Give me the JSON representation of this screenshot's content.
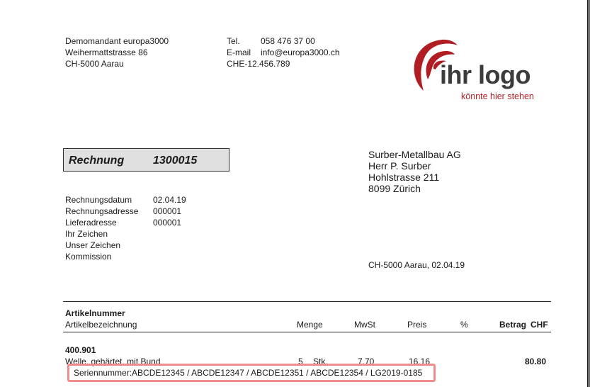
{
  "sender": {
    "line1": "Demomandant europa3000",
    "line2": "Weihermattstrasse 86",
    "line3": "CH-5000 Aarau"
  },
  "contact": {
    "tel_label": "Tel.",
    "tel_value": "058 476 37 00",
    "email_label": "E-mail",
    "email_value": "info@europa3000.ch",
    "vat": "CHE-12.456.789"
  },
  "logo": {
    "main": "ihr logo",
    "sub": "könnte hier stehen",
    "accent": "#b01e23"
  },
  "document": {
    "title": "Rechnung",
    "number": "1300015"
  },
  "recipient": {
    "line1": "Surber-Metallbau AG",
    "line2": "Herr P. Surber",
    "line3": "Hohlstrasse 211",
    "line4": "8099 Zürich"
  },
  "meta": {
    "date_label": "Rechnungsdatum",
    "date_value": "02.04.19",
    "billing_label": "Rechnungsadresse",
    "billing_value": "000001",
    "delivery_label": "Lieferadresse",
    "delivery_value": "000001",
    "your_ref_label": "Ihr Zeichen",
    "our_ref_label": "Unser Zeichen",
    "commission_label": "Kommission"
  },
  "place_date": "CH-5000 Aarau, 02.04.19",
  "table": {
    "headers": {
      "article_number": "Artikelnummer",
      "article_description": "Artikelbezeichnung",
      "quantity": "Menge",
      "vat": "MwSt",
      "price": "Preis",
      "percent": "%",
      "amount": "Betrag",
      "currency": "CHF"
    },
    "rows": [
      {
        "article_number": "400.901",
        "description": "Welle, gehärtet, mit Bund",
        "quantity": "5",
        "unit": "Stk.",
        "vat": "7.70",
        "price": "16.16",
        "amount": "80.80",
        "serial_label": "Seriennummer:",
        "serial_numbers": "ABCDE12345 / ABCDE12347 / ABCDE12351 / ABCDE12354 / LG2019-0185"
      }
    ]
  },
  "colors": {
    "highlight": "#f08c8c",
    "title_box_bg": "#e0e0e0"
  }
}
